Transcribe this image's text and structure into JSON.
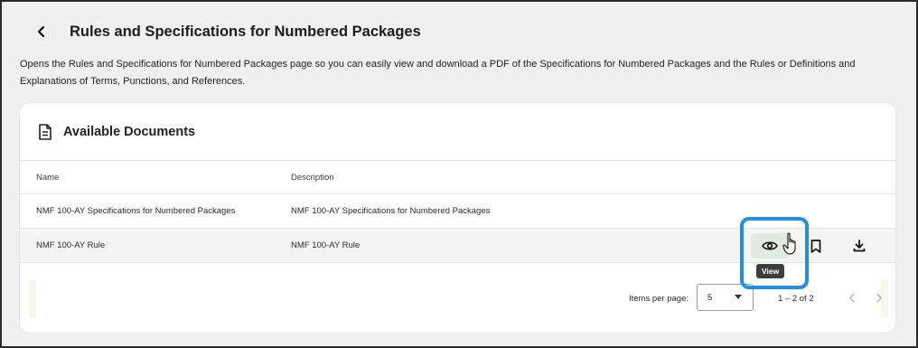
{
  "page": {
    "title": "Rules and Specifications for Numbered Packages",
    "description": "Opens the Rules and Specifications for Numbered Packages page so you can easily view and download a PDF of the Specifications for Numbered Packages and the Rules or Definitions and Explanations of Terms, Punctions, and References."
  },
  "card": {
    "title": "Available Documents",
    "icon": "document-icon",
    "columns": {
      "name": "Name",
      "description": "Description"
    },
    "rows": [
      {
        "name": "NMF 100-AY Specifications for Numbered Packages",
        "description": "NMF 100-AY Specifications for Numbered Packages"
      },
      {
        "name": "NMF 100-AY Rule",
        "description": "NMF 100-AY Rule"
      }
    ]
  },
  "actions": {
    "view_tooltip": "View",
    "icons": [
      "eye-icon",
      "bookmark-icon",
      "download-icon"
    ]
  },
  "pagination": {
    "items_per_page_label": "Items per page:",
    "items_per_page_value": "5",
    "range": "1 – 2 of 2"
  },
  "colors": {
    "highlight": "#1e8ee8",
    "page_background": "#f0f0f0",
    "view_button_bg": "#e2ebe0"
  }
}
